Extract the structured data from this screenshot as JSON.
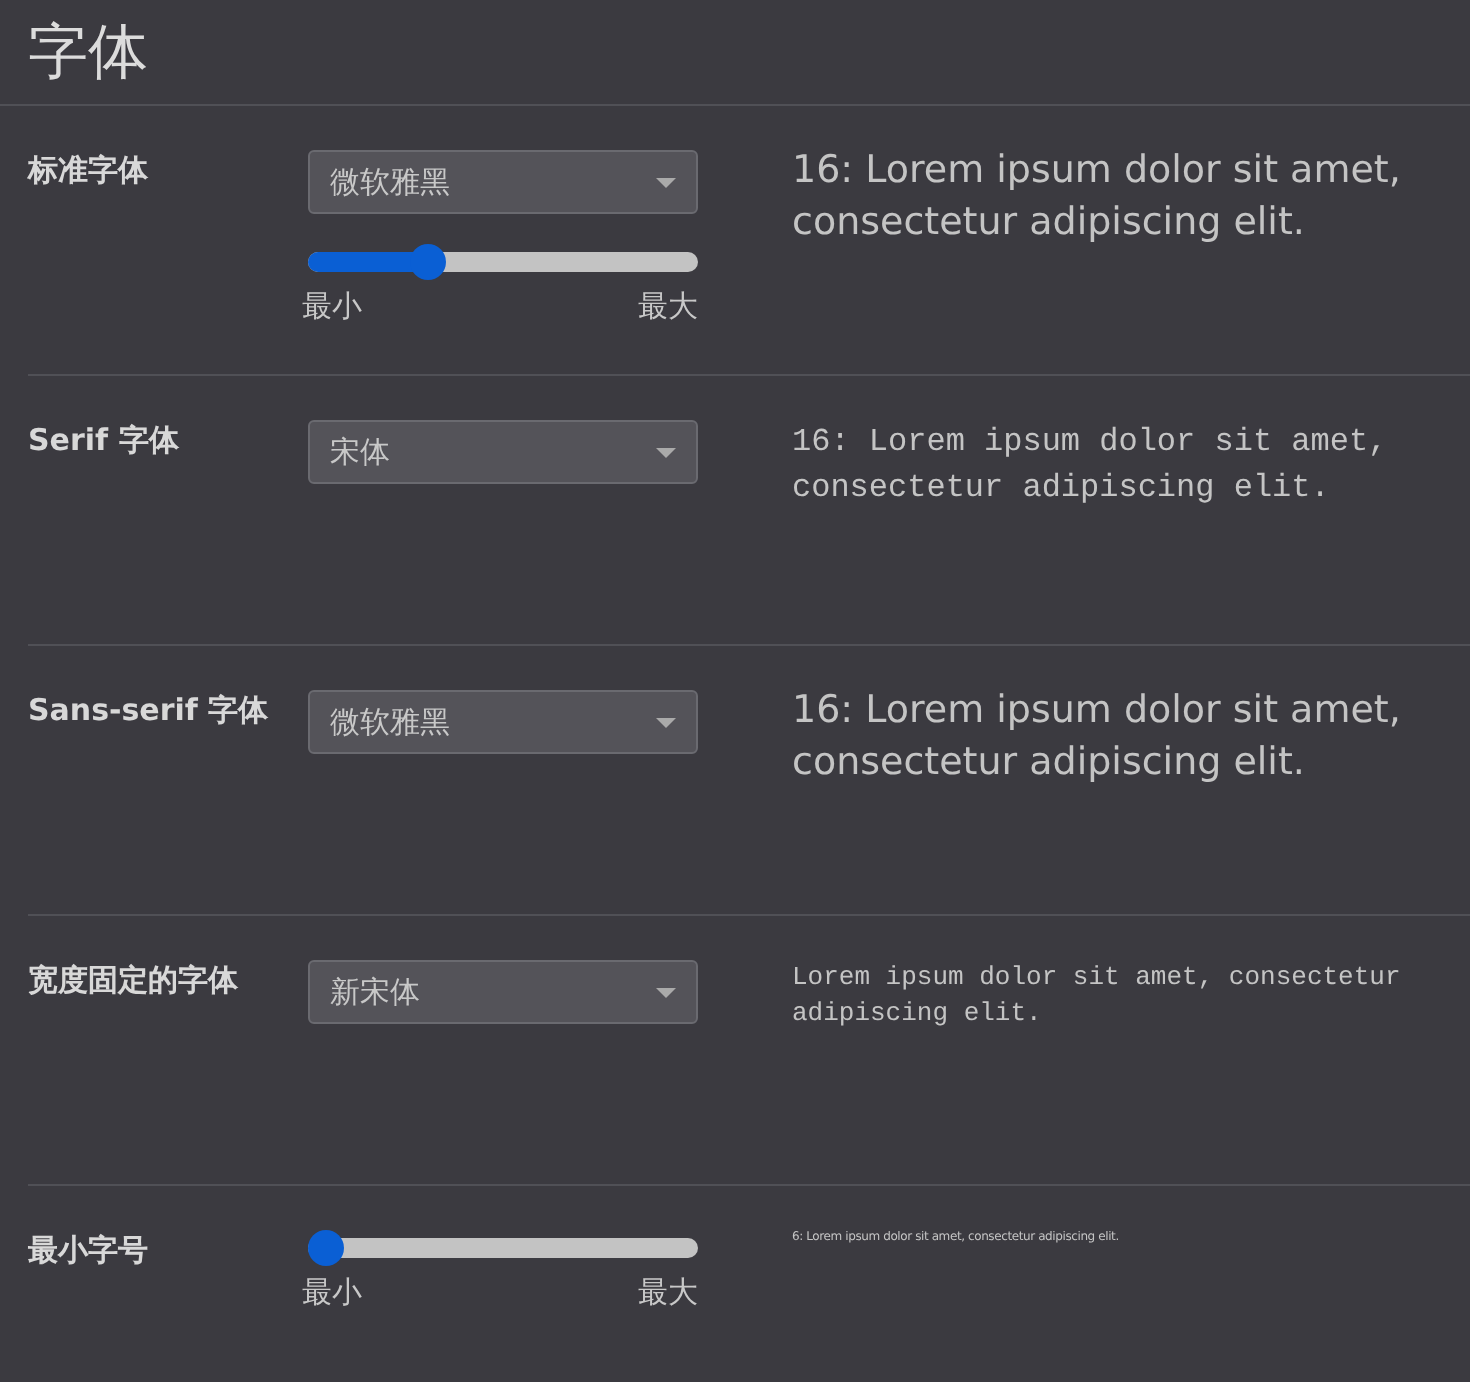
{
  "title": "字体",
  "settings": [
    {
      "label": "标准字体",
      "kind": "sans",
      "dropdown": {
        "value": "微软雅黑"
      },
      "slider": {
        "level": 0.31,
        "min_label": "最小",
        "max_label": "最大"
      },
      "sample": "16: Lorem ipsum dolor sit amet, consectetur adipiscing elit."
    },
    {
      "label": "Serif 字体",
      "kind": "serif",
      "dropdown": {
        "value": "宋体"
      },
      "sample": "16: Lorem ipsum dolor sit amet, consectetur adipiscing elit."
    },
    {
      "label": "Sans-serif 字体",
      "kind": "sans",
      "dropdown": {
        "value": "微软雅黑"
      },
      "sample": "16: Lorem ipsum dolor sit amet, consectetur adipiscing elit."
    },
    {
      "label": "宽度固定的字体",
      "kind": "mono",
      "dropdown": {
        "value": "新宋体"
      },
      "sample": "Lorem ipsum dolor sit amet, consectetur adipiscing elit."
    },
    {
      "label": "最小字号",
      "kind": "tiny",
      "slider": {
        "level": 0,
        "min_label": "最小",
        "max_label": "最大"
      },
      "sample": "6: Lorem ipsum dolor sit amet, consectetur adipiscing elit."
    }
  ]
}
